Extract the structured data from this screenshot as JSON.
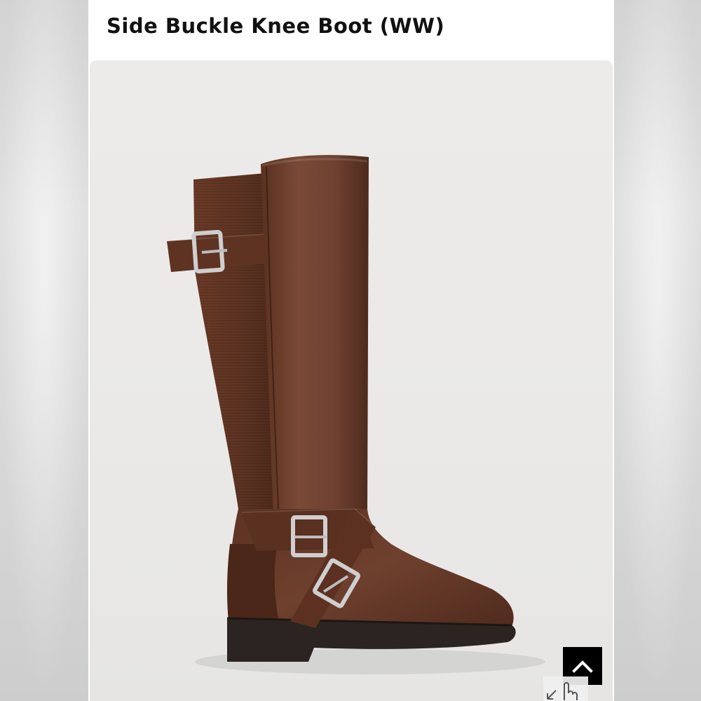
{
  "product": {
    "title": "Side Buckle Knee Boot (WW)",
    "image_alt": "Brown side buckle knee boot"
  },
  "controls": {
    "back_to_top_icon": "chevron-up-icon",
    "zoom_hint_icon": "pinch-zoom-hand-icon"
  },
  "colors": {
    "boot_leather": "#6b3d2b",
    "boot_stretch": "#5d3424",
    "sole": "#2b2421",
    "buckle": "#c9c9c9",
    "background": "#ebeae8"
  }
}
